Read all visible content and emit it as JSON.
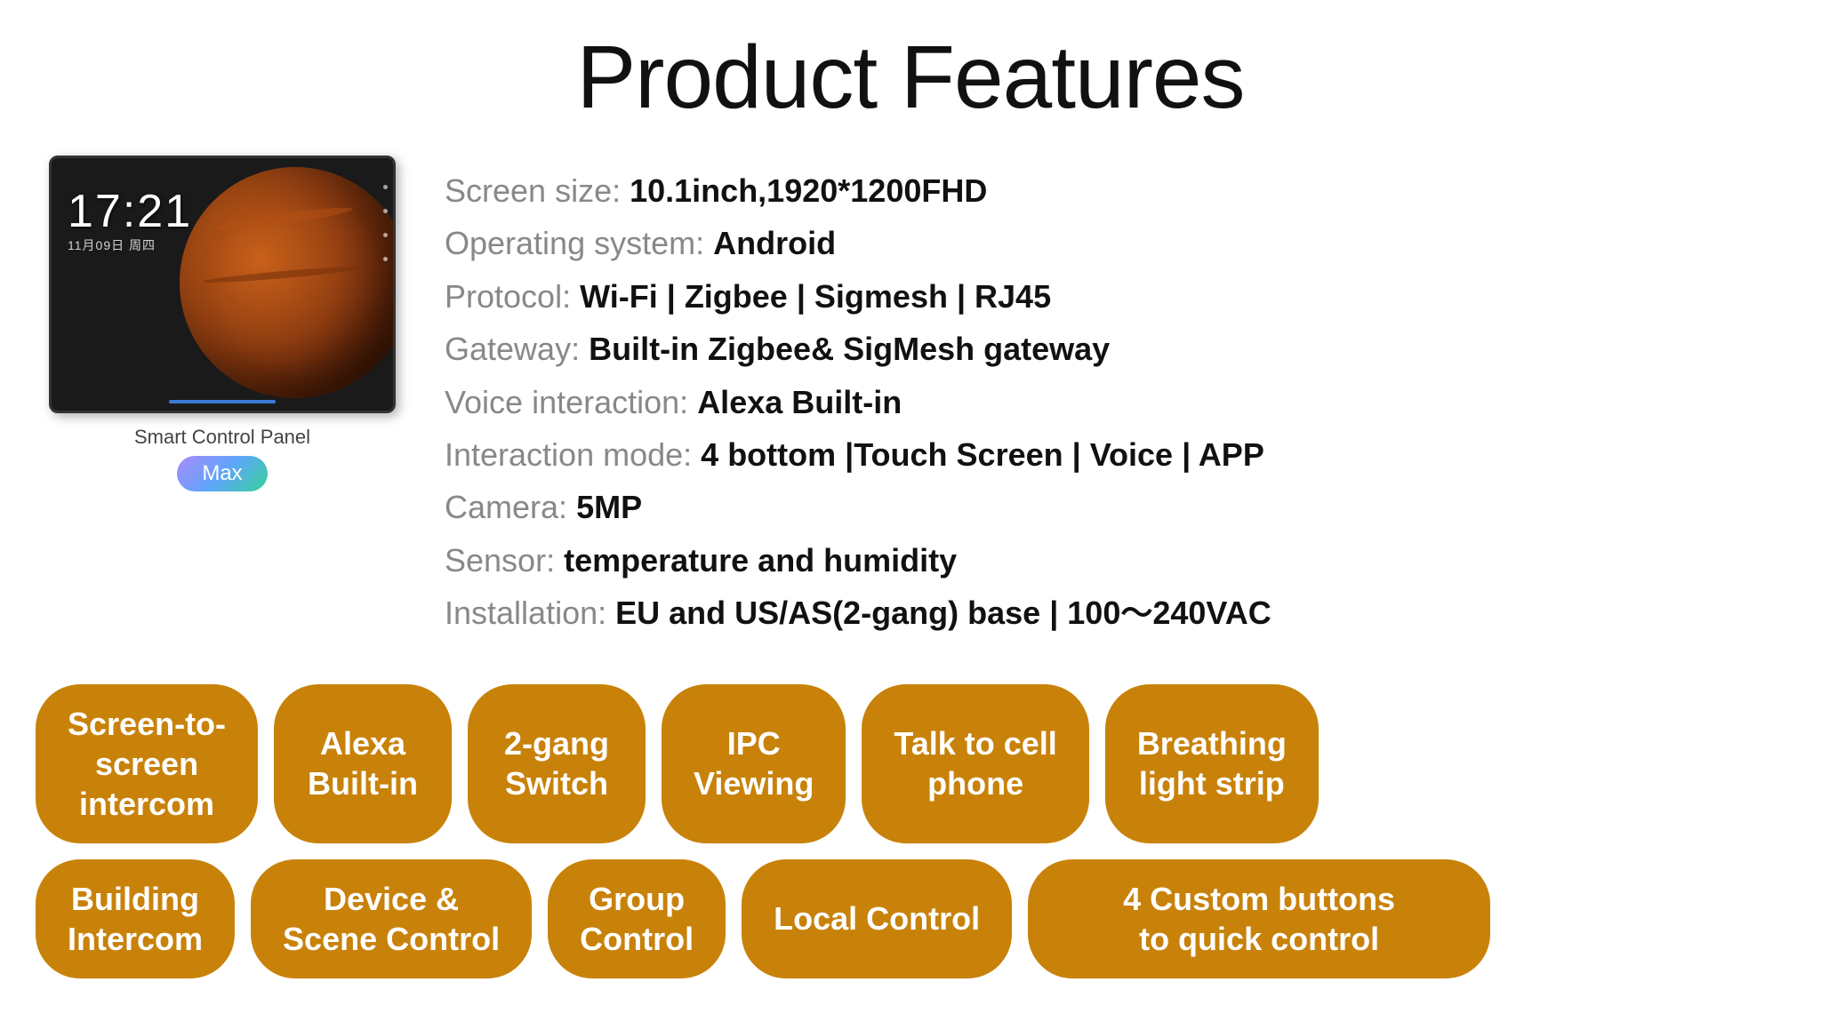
{
  "header": {
    "title": "Product Features"
  },
  "device": {
    "time": "17:21",
    "date": "11月09日 周四",
    "label": "Smart Control Panel",
    "badge": "Max"
  },
  "specs": [
    {
      "label": "Screen size:",
      "value": "10.1inch,1920*1200FHD"
    },
    {
      "label": "Operating system:",
      "value": "Android"
    },
    {
      "label": "Protocol:",
      "value": "Wi-Fi | Zigbee | Sigmesh | RJ45"
    },
    {
      "label": "Gateway:",
      "value": "Built-in Zigbee& SigMesh gateway"
    },
    {
      "label": "Voice interaction:",
      "value": "Alexa Built-in"
    },
    {
      "label": "Interaction mode:",
      "value": "4 bottom |Touch Screen |  Voice | APP"
    },
    {
      "label": "Camera:",
      "value": "5MP"
    },
    {
      "label": "Sensor:",
      "value": "temperature and humidity"
    },
    {
      "label": "Installation:",
      "value": "EU and US/AS(2-gang) base | 100～240VAC"
    }
  ],
  "pills_row1": [
    {
      "id": "screen-to-screen-intercom",
      "text": "Screen-to-\nscreen\nintercom"
    },
    {
      "id": "alexa-built-in",
      "text": "Alexa\nBuilt-in"
    },
    {
      "id": "2-gang-switch",
      "text": "2-gang\nSwitch"
    },
    {
      "id": "ipc-viewing",
      "text": "IPC\nViewing"
    },
    {
      "id": "talk-to-cell-phone",
      "text": "Talk to cell\nphone"
    },
    {
      "id": "breathing-light-strip",
      "text": "Breathing\nlight strip"
    }
  ],
  "pills_row2": [
    {
      "id": "building-intercom",
      "text": "Building\nIntercom"
    },
    {
      "id": "device-scene-control",
      "text": "Device &\nScene Control"
    },
    {
      "id": "group-control",
      "text": "Group\nControl"
    },
    {
      "id": "local-control",
      "text": "Local Control"
    },
    {
      "id": "4-custom-buttons",
      "text": "4 Custom buttons\nto quick control"
    }
  ]
}
